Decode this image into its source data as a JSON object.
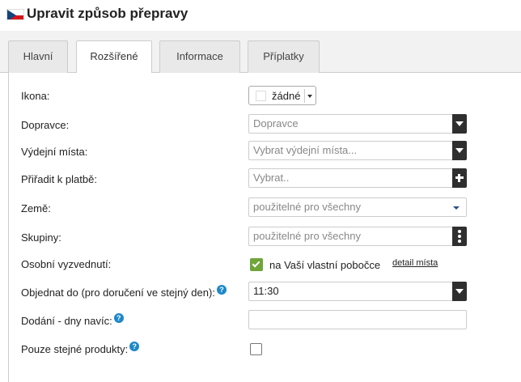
{
  "header": {
    "title": "Upravit způsob přepravy"
  },
  "tabs": [
    {
      "label": "Hlavní"
    },
    {
      "label": "Rozšířené",
      "active": true
    },
    {
      "label": "Informace"
    },
    {
      "label": "Příplatky"
    }
  ],
  "form": {
    "icon": {
      "label": "Ikona:",
      "value": "žádné"
    },
    "carrier": {
      "label": "Dopravce:",
      "placeholder": "Dopravce"
    },
    "pickup_points": {
      "label": "Výdejní místa:",
      "placeholder": "Vybrat výdejní místa..."
    },
    "assign_payment": {
      "label": "Přiřadit k platbě:",
      "placeholder": "Vybrat.."
    },
    "country": {
      "label": "Země:",
      "value": "použitelné pro všechny"
    },
    "groups": {
      "label": "Skupiny:",
      "value": "použitelné pro všechny"
    },
    "personal_pickup": {
      "label": "Osobní vyzvednutí:",
      "option_text": "na Vaší vlastní pobočce",
      "link": "detail místa",
      "checked": true
    },
    "order_by": {
      "label": "Objednat do (pro doručení ve stejný den):",
      "value": "11:30",
      "help": "?"
    },
    "delivery_days": {
      "label": "Dodání - dny navíc:",
      "value": "",
      "help": "?"
    },
    "same_products": {
      "label": "Pouze stejné produkty:",
      "checked": false,
      "help": "?"
    }
  },
  "colors": {
    "dark_button": "#2f2f2f",
    "checkbox_green": "#6fa53a",
    "help_blue": "#1e88c9"
  }
}
